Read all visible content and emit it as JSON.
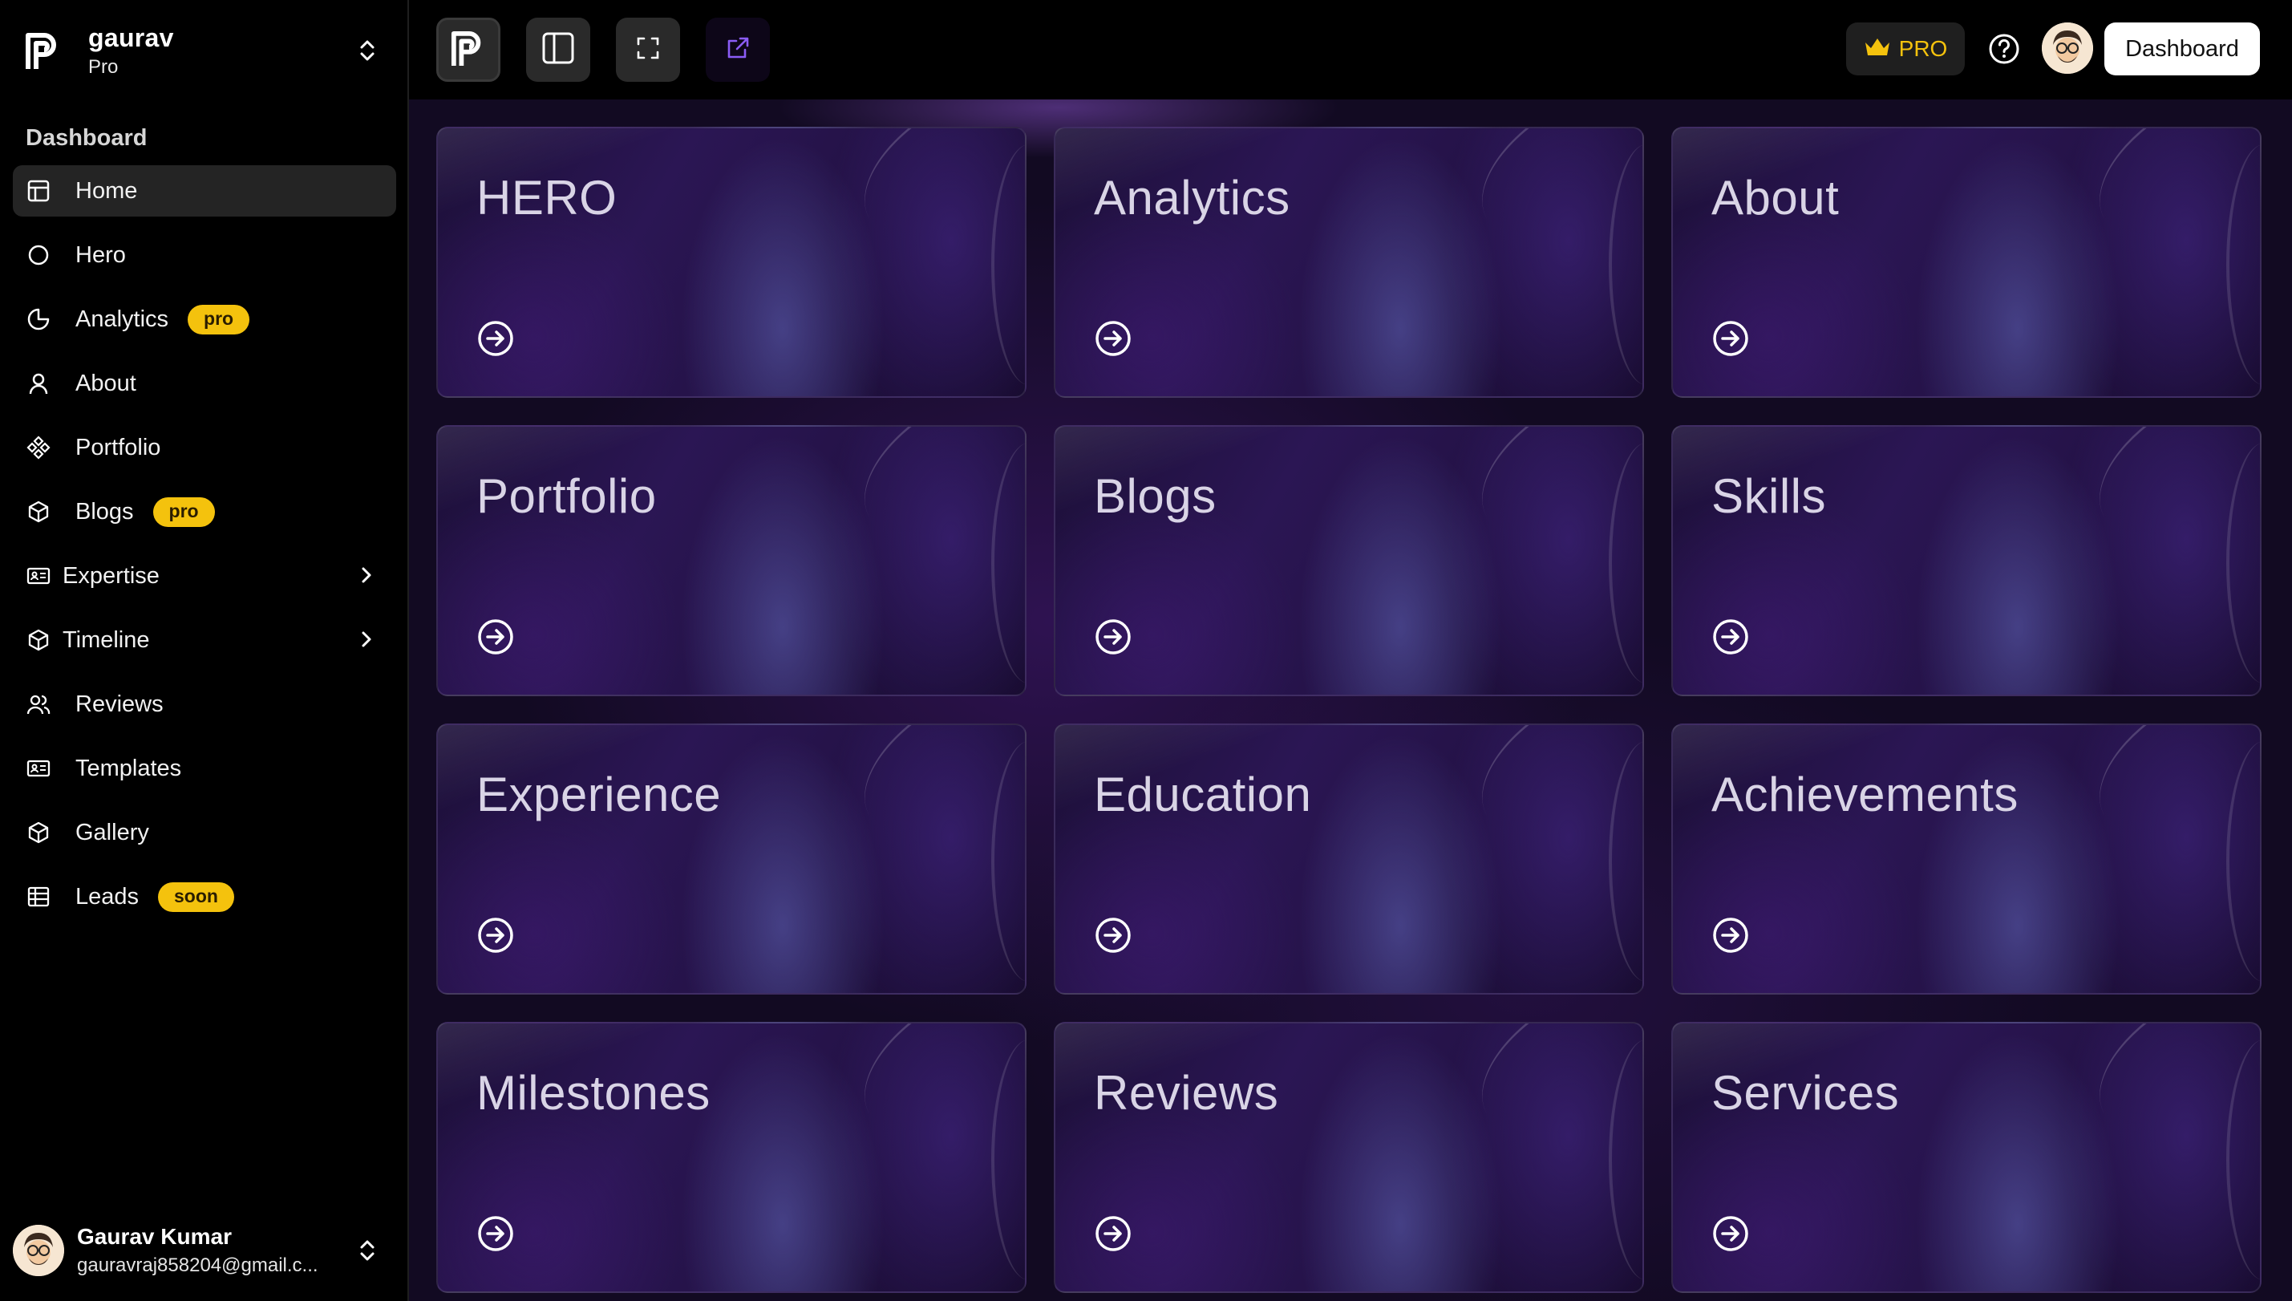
{
  "workspace": {
    "name": "gaurav",
    "plan": "Pro"
  },
  "sidebar": {
    "group_label": "Dashboard",
    "items": [
      {
        "label": "Home",
        "icon": "layout-icon",
        "active": true
      },
      {
        "label": "Hero",
        "icon": "circle-icon"
      },
      {
        "label": "Analytics",
        "icon": "pie-chart-icon",
        "badge": "pro"
      },
      {
        "label": "About",
        "icon": "user-icon"
      },
      {
        "label": "Portfolio",
        "icon": "diamonds-icon"
      },
      {
        "label": "Blogs",
        "icon": "package-icon",
        "badge": "pro"
      },
      {
        "label": "Expertise",
        "icon": "id-card-icon",
        "expandable": true
      },
      {
        "label": "Timeline",
        "icon": "package-icon",
        "expandable": true
      },
      {
        "label": "Reviews",
        "icon": "users-icon"
      },
      {
        "label": "Templates",
        "icon": "id-card-icon"
      },
      {
        "label": "Gallery",
        "icon": "package-icon"
      },
      {
        "label": "Leads",
        "icon": "table-icon",
        "badge": "soon"
      }
    ]
  },
  "user": {
    "name": "Gaurav Kumar",
    "email": "gauravraj858204@gmail.c..."
  },
  "topbar": {
    "pro_label": "PRO",
    "dashboard_label": "Dashboard"
  },
  "cards": [
    {
      "title": "HERO"
    },
    {
      "title": "Analytics"
    },
    {
      "title": "About"
    },
    {
      "title": "Portfolio"
    },
    {
      "title": "Blogs"
    },
    {
      "title": "Skills"
    },
    {
      "title": "Experience"
    },
    {
      "title": "Education"
    },
    {
      "title": "Achievements"
    },
    {
      "title": "Milestones"
    },
    {
      "title": "Reviews"
    },
    {
      "title": "Services"
    }
  ],
  "colors": {
    "badge": "#f4c20d",
    "accent_purple": "#8b5cf6",
    "background": "#000000"
  }
}
